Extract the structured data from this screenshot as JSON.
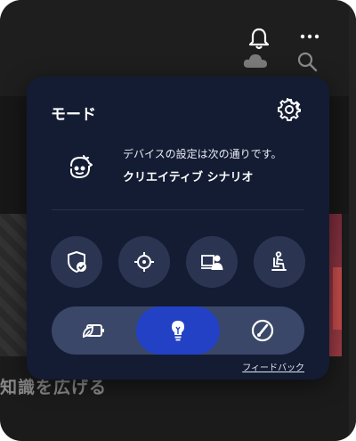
{
  "panel": {
    "title": "モード",
    "description_line1": "デバイスの設定は次の通りです。",
    "description_line2": "クリエイティブ シナリオ",
    "feedback_label": "フィードバック"
  },
  "background": {
    "text": "知識を広げる"
  },
  "feature_buttons": [
    {
      "icon": "shield-check-icon"
    },
    {
      "icon": "crosshair-icon"
    },
    {
      "icon": "person-screen-icon"
    },
    {
      "icon": "seated-person-icon"
    }
  ],
  "mode_segments": [
    {
      "icon": "battery-leaf-icon",
      "active": false
    },
    {
      "icon": "lightbulb-icon",
      "active": true
    },
    {
      "icon": "performance-gauge-icon",
      "active": false
    }
  ],
  "colors": {
    "panel": "#141c33",
    "active_segment": "#2341c4",
    "button_bg": "#2b3552"
  }
}
